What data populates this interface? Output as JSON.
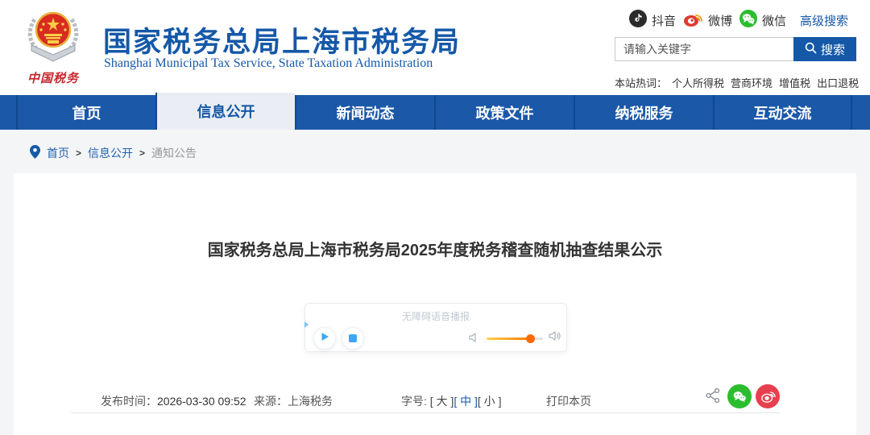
{
  "brand": {
    "title": "国家税务总局上海市税务局",
    "subtitle": "Shanghai Municipal Tax Service, State Taxation Administration",
    "emblem_caption": "中国税务"
  },
  "topbar": {
    "douyin_label": "抖音",
    "weibo_label": "微博",
    "wechat_label": "微信",
    "advanced_search": "高级搜索"
  },
  "search": {
    "placeholder": "请输入关键字",
    "button_label": "搜索",
    "hot_label": "本站热词：",
    "hot_words": {
      "0": "个人所得税",
      "1": "营商环境",
      "2": "增值税",
      "3": "出口退税"
    }
  },
  "nav": {
    "items": {
      "0": {
        "label": "首页"
      },
      "1": {
        "label": "信息公开"
      },
      "2": {
        "label": "新闻动态"
      },
      "3": {
        "label": "政策文件"
      },
      "4": {
        "label": "纳税服务"
      },
      "5": {
        "label": "互动交流"
      }
    }
  },
  "breadcrumb": {
    "separator": ">",
    "items": {
      "0": "首页",
      "1": "信息公开",
      "2": "通知公告"
    }
  },
  "article": {
    "title": "国家税务总局上海市税务局2025年度税务稽查随机抽查结果公示",
    "player_label": "无障碍语音播报",
    "meta": {
      "publish_label": "发布时间：",
      "publish_time": "2026-03-30 09:52",
      "source_label": "来源：",
      "source": "上海税务",
      "fontsize_label": "字号: ",
      "size_large": "[ 大 ]",
      "size_medium": "[ 中 ]",
      "size_small": "[ 小 ]",
      "print": "打印本页"
    }
  },
  "colors": {
    "primary_blue": "#1558a8",
    "nav_blue": "#1b58a8",
    "wechat_green": "#2cbd2f",
    "weibo_red": "#e6404e",
    "douyin_black": "#2b2b2b",
    "slider_orange": "#ff6a00",
    "emblem_red": "#c3272b"
  }
}
